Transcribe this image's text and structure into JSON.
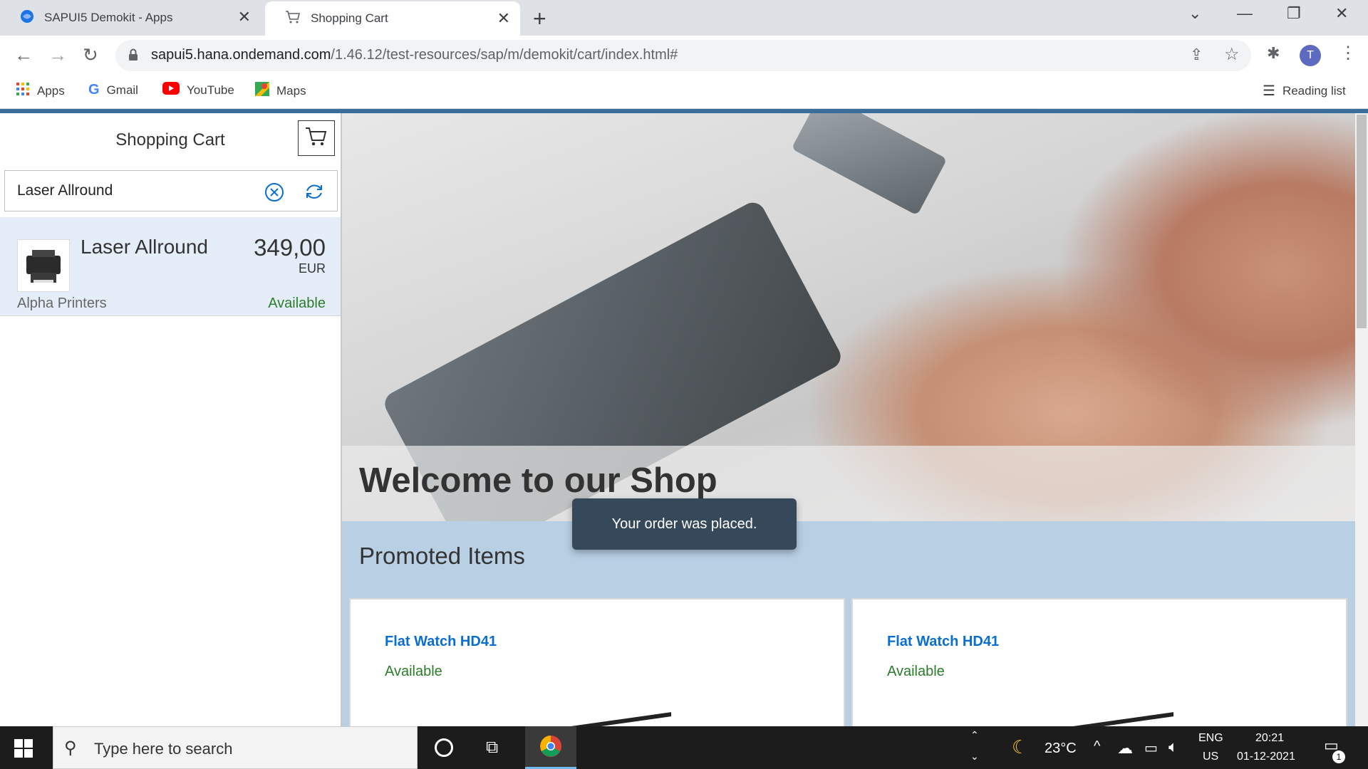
{
  "browser": {
    "tabs": [
      {
        "title": "SAPUI5 Demokit - Apps",
        "icon": "sap-globe-icon",
        "active": false
      },
      {
        "title": "Shopping Cart",
        "icon": "cart-icon",
        "active": true
      }
    ],
    "new_tab": "+",
    "url_host": "sapui5.hana.ondemand.com",
    "url_path": "/1.46.12/test-resources/sap/m/demokit/cart/index.html#",
    "profile_initial": "T",
    "bookmarks": [
      {
        "label": "Apps",
        "icon": "apps-grid-icon"
      },
      {
        "label": "Gmail",
        "icon": "google-icon"
      },
      {
        "label": "YouTube",
        "icon": "youtube-icon"
      },
      {
        "label": "Maps",
        "icon": "maps-icon"
      }
    ],
    "reading_list": "Reading list"
  },
  "app": {
    "master_title": "Shopping Cart",
    "search_value": "Laser Allround",
    "product": {
      "name": "Laser Allround",
      "price": "349,00",
      "currency": "EUR",
      "supplier": "Alpha Printers",
      "status": "Available"
    },
    "welcome": "Welcome to our Shop",
    "promoted_title": "Promoted Items",
    "promoted": [
      {
        "name": "Flat Watch HD41",
        "status": "Available"
      },
      {
        "name": "Flat Watch HD41",
        "status": "Available"
      }
    ],
    "toast": "Your order was placed."
  },
  "taskbar": {
    "search_placeholder": "Type here to search",
    "weather": "23°C",
    "lang_top": "ENG",
    "lang_bottom": "US",
    "time": "20:21",
    "date": "01-12-2021",
    "notification_count": "1"
  },
  "colors": {
    "accent_blue": "#0a6ed1",
    "status_green": "#2b7d2b",
    "selection_bg": "#e5eef8",
    "promo_bg": "#b8cfe4",
    "toast_bg": "#35495a"
  }
}
